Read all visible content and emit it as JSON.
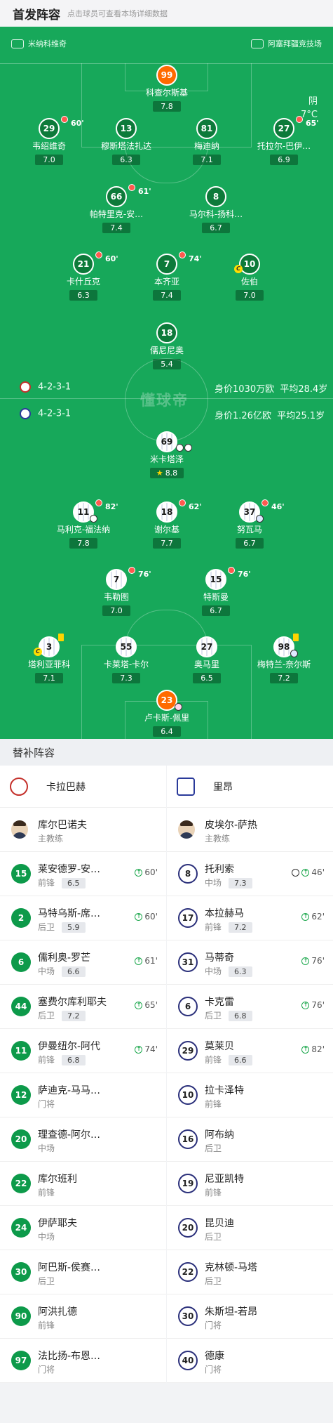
{
  "header": {
    "title": "首发阵容",
    "hint": "点击球员可查看本场详细数据"
  },
  "teams": {
    "home": "米纳科维奇",
    "away": "阿塞拜疆竞技场"
  },
  "weather": {
    "condition": "阴",
    "temp": "7°C"
  },
  "home_info": {
    "formation": "4-2-3-1",
    "value": "身价1030万欧",
    "age": "平均28.4岁"
  },
  "away_info": {
    "formation": "4-2-3-1",
    "value": "身价1.26亿欧",
    "age": "平均25.1岁"
  },
  "watermark": "懂球帝",
  "home_players": [
    {
      "num": "99",
      "name": "科查尔斯基",
      "rating": "7.8",
      "sub": "",
      "gk": true
    },
    {
      "num": "29",
      "name": "韦绍维奇",
      "rating": "7.0",
      "sub": "60'"
    },
    {
      "num": "13",
      "name": "穆斯塔法扎达",
      "rating": "6.3",
      "sub": ""
    },
    {
      "num": "81",
      "name": "梅迪纳",
      "rating": "7.1",
      "sub": ""
    },
    {
      "num": "27",
      "name": "托拉尔-巴伊…",
      "rating": "6.9",
      "sub": "65'"
    },
    {
      "num": "66",
      "name": "帕特里克-安…",
      "rating": "7.4",
      "sub": "61'"
    },
    {
      "num": "8",
      "name": "马尔科-扬科…",
      "rating": "6.7",
      "sub": ""
    },
    {
      "num": "21",
      "name": "卡什丘克",
      "rating": "6.3",
      "sub": "60'"
    },
    {
      "num": "7",
      "name": "本齐亚",
      "rating": "7.4",
      "sub": "74'"
    },
    {
      "num": "10",
      "name": "佐伯",
      "rating": "7.0",
      "sub": "",
      "captain": true
    },
    {
      "num": "18",
      "name": "儒尼尼奥",
      "rating": "5.4",
      "sub": ""
    }
  ],
  "away_players": [
    {
      "num": "69",
      "name": "米卡塔泽",
      "rating": "8.8",
      "sub": "",
      "star": true
    },
    {
      "num": "11",
      "name": "马利克-福法纳",
      "rating": "7.8",
      "sub": "82'"
    },
    {
      "num": "18",
      "name": "谢尔基",
      "rating": "7.7",
      "sub": "62'"
    },
    {
      "num": "37",
      "name": "努瓦马",
      "rating": "6.7",
      "sub": "46'"
    },
    {
      "num": "7",
      "name": "韦勒图",
      "rating": "7.0",
      "sub": "76'"
    },
    {
      "num": "15",
      "name": "特斯曼",
      "rating": "6.7",
      "sub": "76'"
    },
    {
      "num": "3",
      "name": "塔利亚菲科",
      "rating": "7.1",
      "sub": "",
      "captain": true
    },
    {
      "num": "55",
      "name": "卡莱塔-卡尔",
      "rating": "7.3",
      "sub": ""
    },
    {
      "num": "27",
      "name": "奥马里",
      "rating": "6.5",
      "sub": ""
    },
    {
      "num": "98",
      "name": "梅特兰-奈尔斯",
      "rating": "7.2",
      "sub": ""
    },
    {
      "num": "23",
      "name": "卢卡斯-佩里",
      "rating": "6.4",
      "sub": "",
      "gk": true
    }
  ],
  "subs_title": "替补阵容",
  "home_bench": {
    "team": "卡拉巴赫",
    "coach": {
      "name": "库尔巴诺夫",
      "role": "主教练"
    },
    "players": [
      {
        "num": "15",
        "name": "莱安德罗-安…",
        "pos": "前锋",
        "rating": "6.5",
        "min": "60'"
      },
      {
        "num": "2",
        "name": "马特乌斯-席…",
        "pos": "后卫",
        "rating": "5.9",
        "min": "60'"
      },
      {
        "num": "6",
        "name": "儒利奥-罗芒",
        "pos": "中场",
        "rating": "6.6",
        "min": "61'"
      },
      {
        "num": "44",
        "name": "塞费尔库利耶夫",
        "pos": "后卫",
        "rating": "7.2",
        "min": "65'"
      },
      {
        "num": "11",
        "name": "伊曼纽尔-阿代",
        "pos": "前锋",
        "rating": "6.8",
        "min": "74'"
      },
      {
        "num": "12",
        "name": "萨迪克-马马…",
        "pos": "门将",
        "rating": "",
        "min": ""
      },
      {
        "num": "20",
        "name": "理查德-阿尔…",
        "pos": "中场",
        "rating": "",
        "min": ""
      },
      {
        "num": "22",
        "name": "库尔班利",
        "pos": "前锋",
        "rating": "",
        "min": ""
      },
      {
        "num": "24",
        "name": "伊萨耶夫",
        "pos": "中场",
        "rating": "",
        "min": ""
      },
      {
        "num": "30",
        "name": "阿巴斯-侯赛…",
        "pos": "后卫",
        "rating": "",
        "min": ""
      },
      {
        "num": "90",
        "name": "阿洪扎德",
        "pos": "前锋",
        "rating": "",
        "min": ""
      },
      {
        "num": "97",
        "name": "法比扬-布恩…",
        "pos": "门将",
        "rating": "",
        "min": ""
      }
    ]
  },
  "away_bench": {
    "team": "里昂",
    "coach": {
      "name": "皮埃尔-萨热",
      "role": "主教练"
    },
    "players": [
      {
        "num": "8",
        "name": "托利索",
        "pos": "中场",
        "rating": "7.3",
        "min": "46'",
        "goal": true
      },
      {
        "num": "17",
        "name": "本拉赫马",
        "pos": "前锋",
        "rating": "7.2",
        "min": "62'"
      },
      {
        "num": "31",
        "name": "马蒂奇",
        "pos": "中场",
        "rating": "6.3",
        "min": "76'"
      },
      {
        "num": "6",
        "name": "卡克雷",
        "pos": "后卫",
        "rating": "6.8",
        "min": "76'"
      },
      {
        "num": "29",
        "name": "莫莱贝",
        "pos": "前锋",
        "rating": "6.6",
        "min": "82'"
      },
      {
        "num": "10",
        "name": "拉卡泽特",
        "pos": "前锋",
        "rating": "",
        "min": ""
      },
      {
        "num": "16",
        "name": "阿布纳",
        "pos": "后卫",
        "rating": "",
        "min": ""
      },
      {
        "num": "19",
        "name": "尼亚凯特",
        "pos": "前锋",
        "rating": "",
        "min": ""
      },
      {
        "num": "20",
        "name": "昆贝迪",
        "pos": "后卫",
        "rating": "",
        "min": ""
      },
      {
        "num": "22",
        "name": "克林顿-马塔",
        "pos": "后卫",
        "rating": "",
        "min": ""
      },
      {
        "num": "30",
        "name": "朱斯坦-若昂",
        "pos": "门将",
        "rating": "",
        "min": ""
      },
      {
        "num": "40",
        "name": "德康",
        "pos": "门将",
        "rating": "",
        "min": ""
      }
    ]
  },
  "colors": {
    "pitch": "#17a85a",
    "home_badge": "#0d7a3a",
    "gk_badge": "#ff6a00",
    "away_ring": "#2a2f7a"
  }
}
